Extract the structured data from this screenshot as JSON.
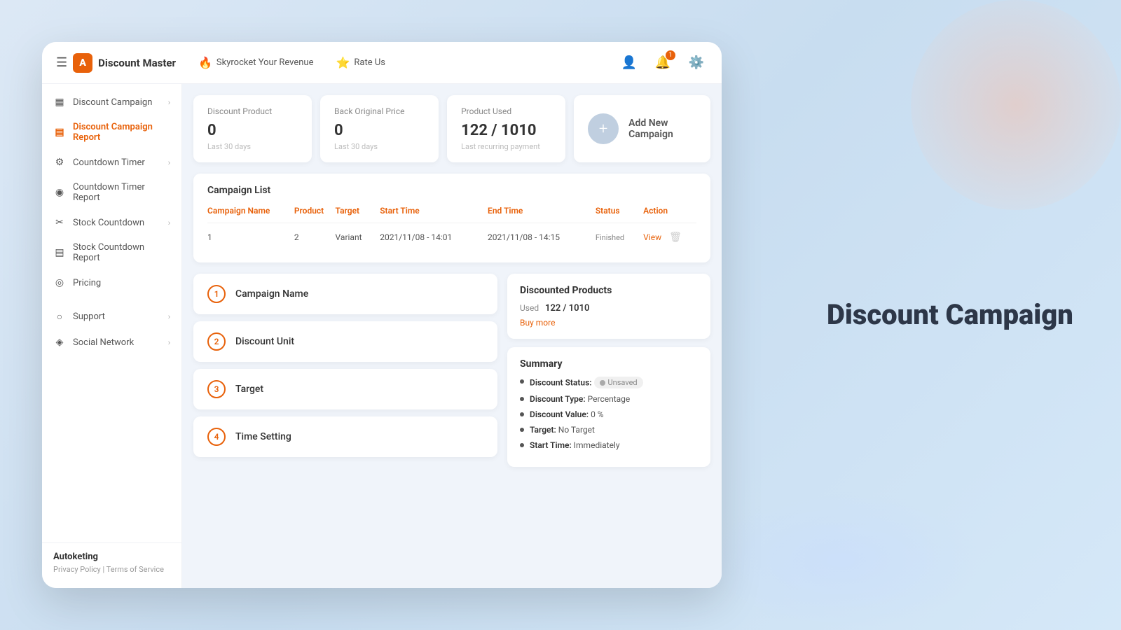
{
  "brand": {
    "name": "Discount Master",
    "logo_letter": "A"
  },
  "navbar": {
    "hamburger": "☰",
    "actions": [
      {
        "icon": "🔥",
        "label": "Skyrocket Your Revenue"
      },
      {
        "icon": "⭐",
        "label": "Rate Us"
      }
    ],
    "right_icons": [
      {
        "name": "user",
        "icon": "👤",
        "badge": null
      },
      {
        "name": "bell",
        "icon": "🔔",
        "badge": "1"
      },
      {
        "name": "settings",
        "icon": "⚙️",
        "badge": null
      }
    ]
  },
  "sidebar": {
    "items": [
      {
        "id": "discount-campaign",
        "icon": "▦",
        "label": "Discount Campaign",
        "has_chevron": true,
        "active": false,
        "indent": false
      },
      {
        "id": "discount-campaign-report",
        "icon": "▤",
        "label": "Discount Campaign Report",
        "has_chevron": false,
        "active": true,
        "indent": false
      },
      {
        "id": "countdown-timer",
        "icon": "⚙",
        "label": "Countdown Timer",
        "has_chevron": true,
        "active": false,
        "indent": false
      },
      {
        "id": "countdown-timer-report",
        "icon": "◉",
        "label": "Countdown Timer Report",
        "has_chevron": false,
        "active": false,
        "indent": false
      },
      {
        "id": "stock-countdown",
        "icon": "✂",
        "label": "Stock Countdown",
        "has_chevron": true,
        "active": false,
        "indent": false
      },
      {
        "id": "stock-countdown-report",
        "icon": "▤",
        "label": "Stock Countdown Report",
        "has_chevron": false,
        "active": false,
        "indent": false
      },
      {
        "id": "pricing",
        "icon": "◎",
        "label": "Pricing",
        "has_chevron": false,
        "active": false,
        "indent": false
      }
    ],
    "bottom_items": [
      {
        "id": "support",
        "icon": "○",
        "label": "Support",
        "has_chevron": true,
        "active": false
      },
      {
        "id": "social-network",
        "icon": "◈",
        "label": "Social Network",
        "has_chevron": true,
        "active": false
      }
    ],
    "footer": {
      "brand": "Autoketing",
      "privacy_label": "Privacy Policy",
      "terms_label": "Terms of Service",
      "separator": "|"
    }
  },
  "stats": [
    {
      "id": "discount-product",
      "label": "Discount Product",
      "value": "0",
      "sublabel": "Last 30 days"
    },
    {
      "id": "back-original-price",
      "label": "Back Original Price",
      "value": "0",
      "sublabel": "Last 30 days"
    },
    {
      "id": "product-used",
      "label": "Product Used",
      "value": "122 / 1010",
      "sublabel": "Last recurring payment"
    }
  ],
  "add_new": {
    "icon": "+",
    "label": "Add New Campaign"
  },
  "campaign_list": {
    "title": "Campaign List",
    "columns": [
      "Campaign Name",
      "Product",
      "Target",
      "Start Time",
      "End Time",
      "Status",
      "Action"
    ],
    "rows": [
      {
        "name": "1",
        "product": "2",
        "target": "Variant",
        "start_time": "2021/11/08 - 14:01",
        "end_time": "2021/11/08 - 14:15",
        "status": "Finished",
        "action_view": "View"
      }
    ]
  },
  "form_steps": [
    {
      "number": "1",
      "label": "Campaign Name"
    },
    {
      "number": "2",
      "label": "Discount Unit"
    },
    {
      "number": "3",
      "label": "Target"
    },
    {
      "number": "4",
      "label": "Time Setting"
    }
  ],
  "discounted_products_panel": {
    "title": "Discounted Products",
    "used_label": "Used",
    "used_value": "122 / 1010",
    "buy_more": "Buy more"
  },
  "summary_panel": {
    "title": "Summary",
    "items": [
      {
        "key": "Discount Status:",
        "value": null,
        "badge": "Unsaved"
      },
      {
        "key": "Discount Type:",
        "value": "Percentage"
      },
      {
        "key": "Discount Value:",
        "value": "0 %"
      },
      {
        "key": "Target:",
        "value": "No Target"
      },
      {
        "key": "Start Time:",
        "value": "Immediately"
      }
    ]
  },
  "right_title": "Discount Campaign"
}
